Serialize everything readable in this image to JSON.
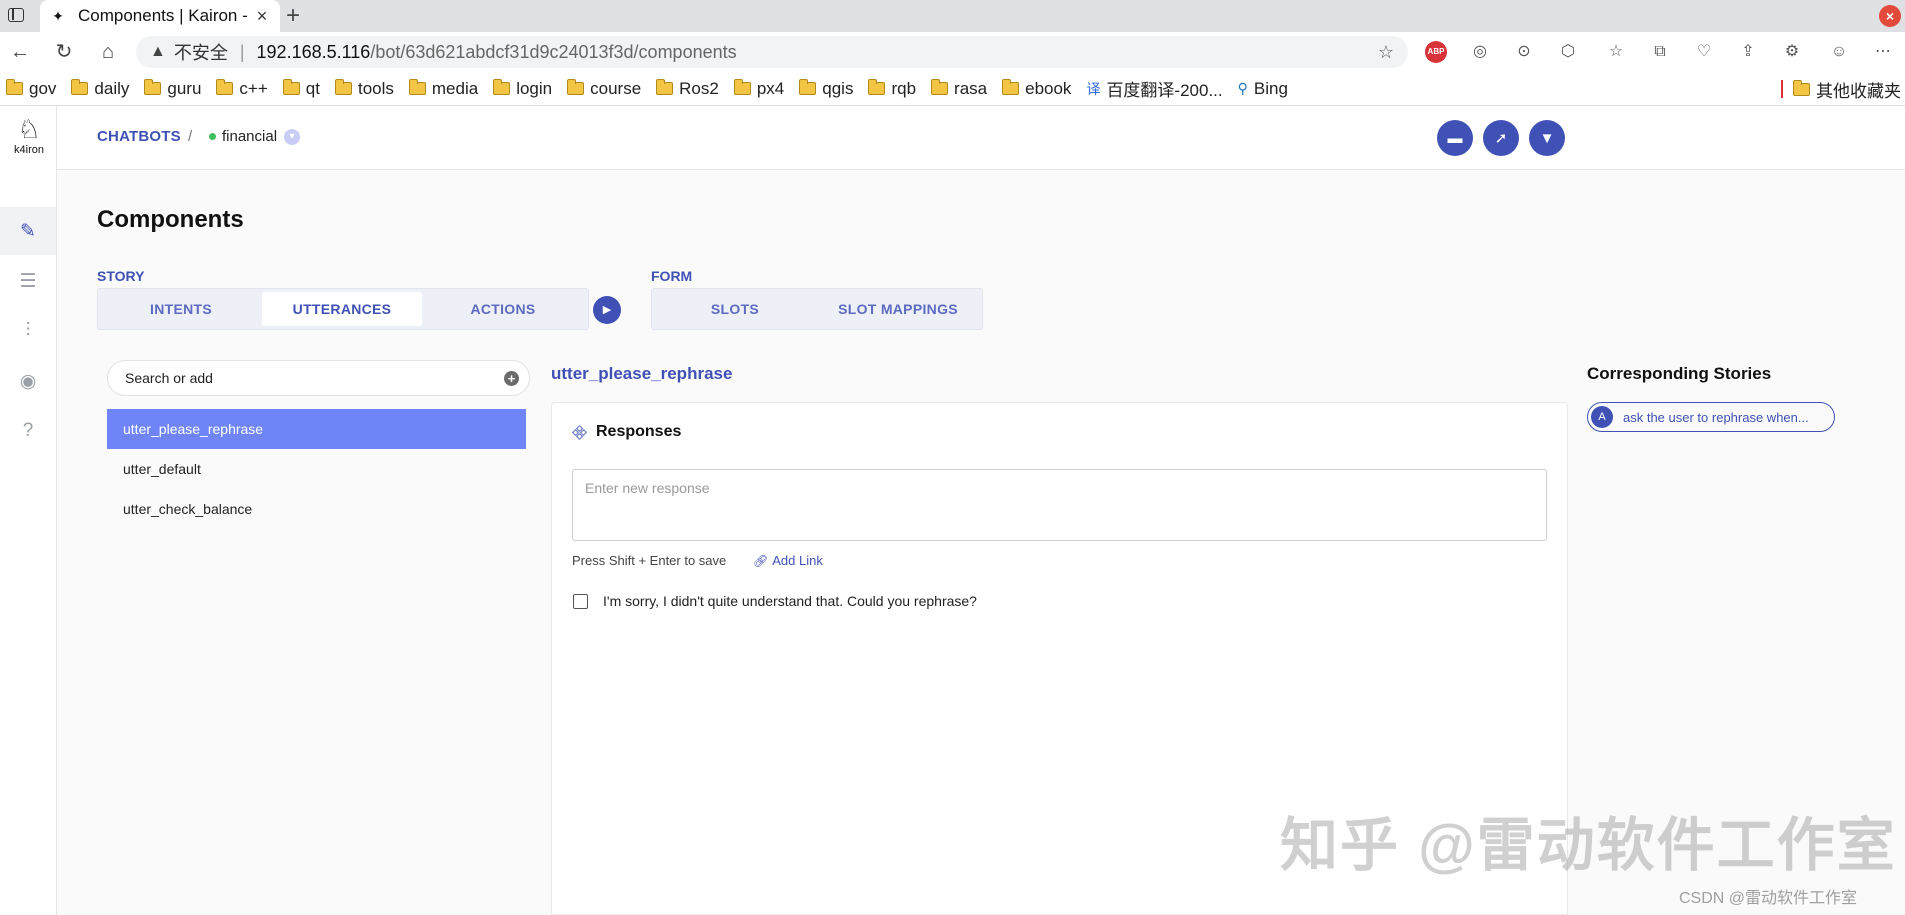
{
  "browser": {
    "tab_title": "Components | Kairon -",
    "url_warning": "不安全",
    "url_host": "192.168.5.116",
    "url_path": "/bot/63d621abdcf31d9c24013f3d/components",
    "bookmarks": [
      {
        "label": "gov",
        "icon": "folder-icon"
      },
      {
        "label": "daily",
        "icon": "folder-icon"
      },
      {
        "label": "guru",
        "icon": "folder-icon"
      },
      {
        "label": "c++",
        "icon": "folder-icon"
      },
      {
        "label": "qt",
        "icon": "folder-icon"
      },
      {
        "label": "tools",
        "icon": "folder-icon"
      },
      {
        "label": "media",
        "icon": "folder-icon"
      },
      {
        "label": "login",
        "icon": "folder-icon"
      },
      {
        "label": "course",
        "icon": "folder-icon"
      },
      {
        "label": "Ros2",
        "icon": "folder-icon"
      },
      {
        "label": "px4",
        "icon": "folder-icon"
      },
      {
        "label": "qgis",
        "icon": "folder-icon"
      },
      {
        "label": "rqb",
        "icon": "folder-icon"
      },
      {
        "label": "rasa",
        "icon": "folder-icon"
      },
      {
        "label": "ebook",
        "icon": "folder-icon"
      },
      {
        "label": "百度翻译-200...",
        "icon": "translate-icon"
      },
      {
        "label": "Bing",
        "icon": "search-icon"
      }
    ],
    "other_bookmarks": "其他收藏夹"
  },
  "app": {
    "logo_text": "k4iron",
    "breadcrumb": {
      "root": "CHATBOTS",
      "separator": "/",
      "bot": "financial"
    },
    "page_title": "Components",
    "story_group": {
      "label": "STORY",
      "tabs": [
        "INTENTS",
        "UTTERANCES",
        "ACTIONS"
      ],
      "active_tab": "UTTERANCES"
    },
    "form_group": {
      "label": "FORM",
      "tabs": [
        "SLOTS",
        "SLOT MAPPINGS"
      ]
    },
    "search": {
      "placeholder": "Search or add"
    },
    "utterances": [
      "utter_please_rephrase",
      "utter_default",
      "utter_check_balance"
    ],
    "selected_utterance": "utter_please_rephrase",
    "responses": {
      "heading": "Responses",
      "input_placeholder": "Enter new response",
      "hint": "Press Shift + Enter to save",
      "add_link": "Add Link",
      "items": [
        "I'm sorry, I didn't quite understand that. Could you rephrase?"
      ]
    },
    "corresponding_stories": {
      "title": "Corresponding Stories",
      "items": [
        {
          "avatar": "A",
          "label": "ask the user to rephrase when..."
        }
      ]
    }
  },
  "watermarks": {
    "big": "知乎 @雷动软件工作室",
    "small": "CSDN @雷动软件工作室"
  },
  "colors": {
    "accent": "#3f51b5",
    "selected_item": "#6f85f7",
    "status_online": "#3fbf5b"
  }
}
